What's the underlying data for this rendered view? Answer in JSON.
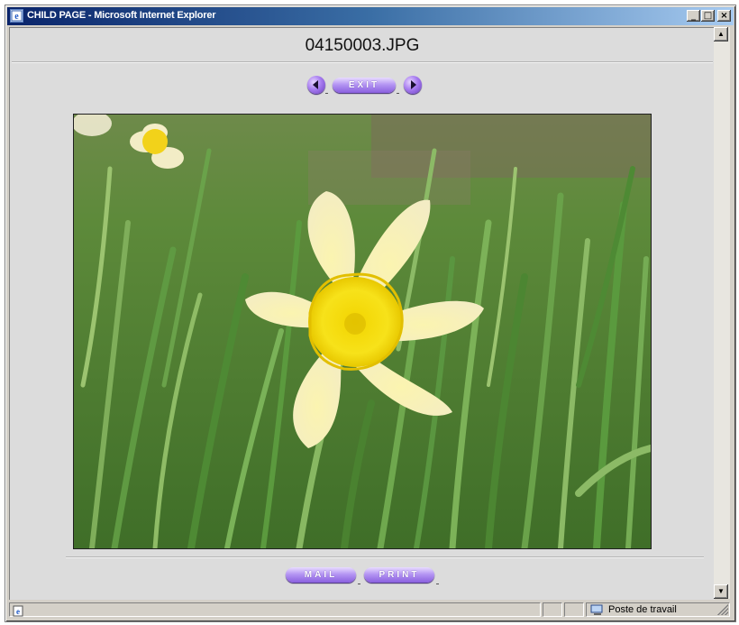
{
  "window": {
    "title": "CHILD PAGE - Microsoft Internet Explorer",
    "minimize_label": "_",
    "maximize_label": "□",
    "close_label": "×"
  },
  "page": {
    "file_name": "04150003.JPG",
    "exit_label": "EXIT",
    "mail_label": "MAIL",
    "print_label": "PRINT",
    "prev_icon": "left-arrow-icon",
    "next_icon": "right-arrow-icon"
  },
  "photo": {
    "subject": "daffodil-flower-image"
  },
  "statusbar": {
    "zone_label": "Poste de travail",
    "zone_icon": "computer-icon",
    "page_icon": "ie-page-icon"
  },
  "colors": {
    "button_purple": "#a77cf0",
    "titlebar_blue": "#0a246a"
  }
}
